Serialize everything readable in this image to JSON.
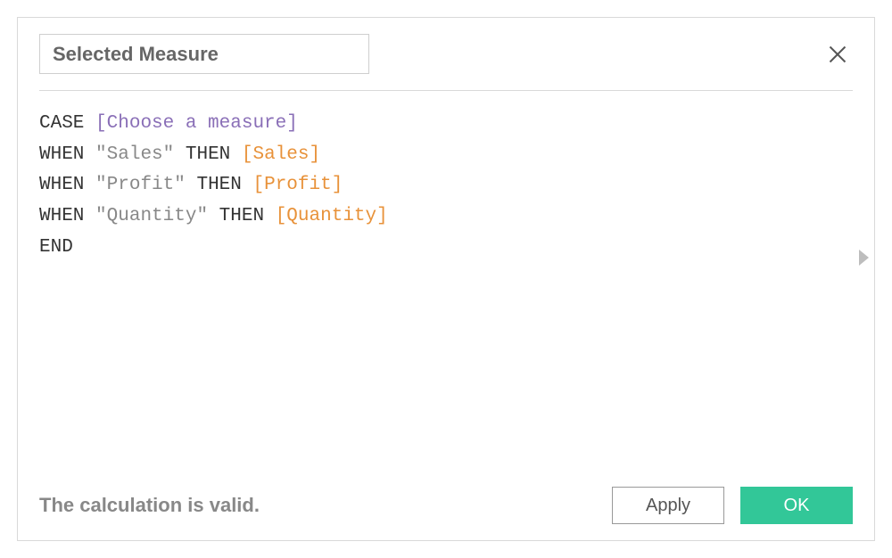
{
  "dialog": {
    "name_value": "Selected Measure",
    "status": "The calculation is valid.",
    "buttons": {
      "apply": "Apply",
      "ok": "OK"
    }
  },
  "formula": {
    "line1": {
      "kw": "CASE",
      "param": "[Choose a measure]"
    },
    "line2": {
      "kw1": "WHEN",
      "str": "\"Sales\"",
      "kw2": "THEN",
      "field": "[Sales]"
    },
    "line3": {
      "kw1": "WHEN",
      "str": "\"Profit\"",
      "kw2": "THEN",
      "field": "[Profit]"
    },
    "line4": {
      "kw1": "WHEN",
      "str": "\"Quantity\"",
      "kw2": "THEN",
      "field": "[Quantity]"
    },
    "line5": {
      "kw": "END"
    }
  }
}
